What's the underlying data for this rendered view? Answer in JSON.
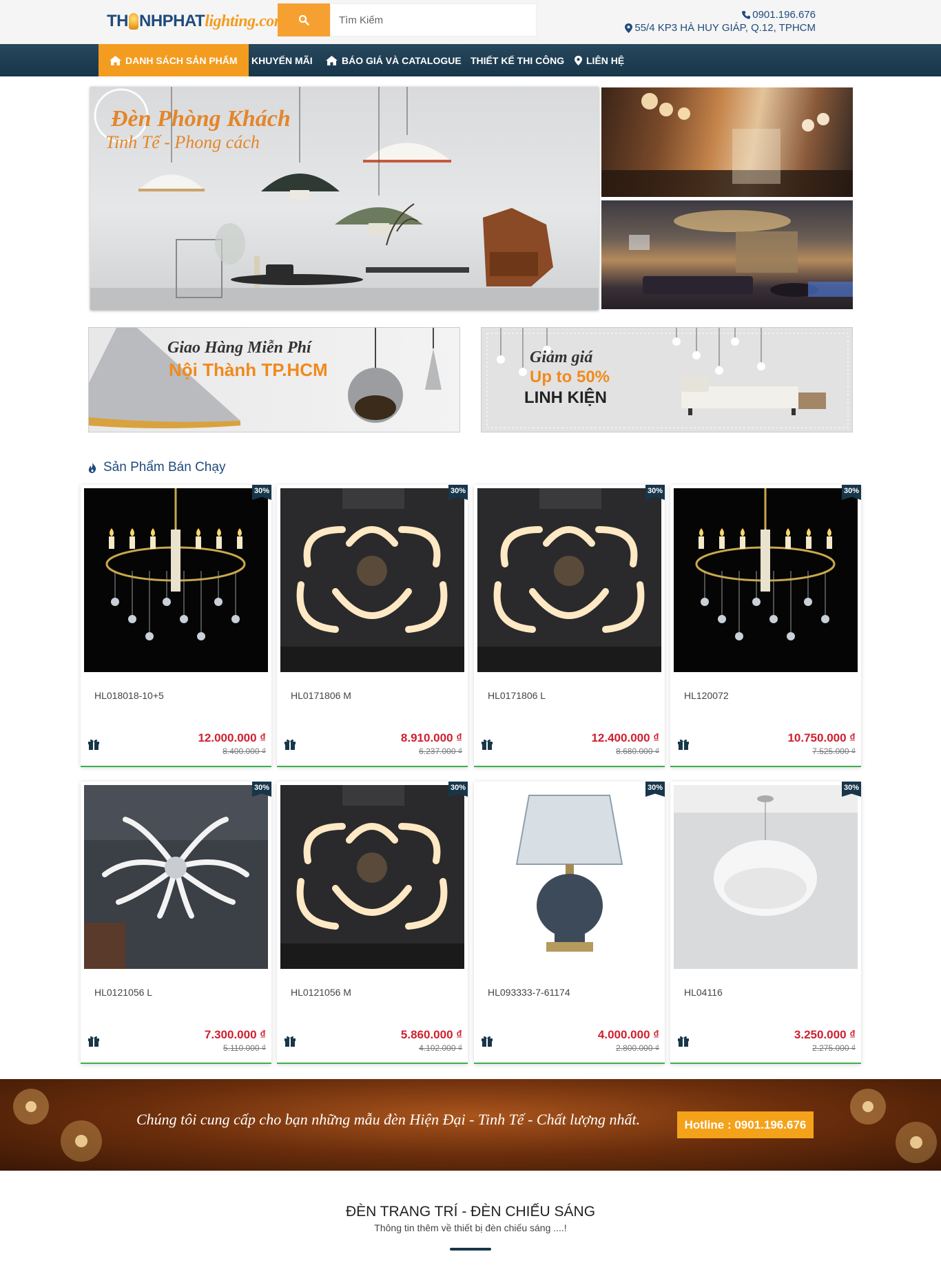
{
  "header": {
    "logo_part1": "TH",
    "logo_part2": "NHPHAT",
    "logo_part3": "lighting.com",
    "search_placeholder": "Tìm Kiếm",
    "phone": "0901.196.676",
    "address": "55/4 KP3 HÀ HUY GIÁP, Q.12, TPHCM"
  },
  "nav": {
    "items": [
      {
        "label": "DANH SÁCH SẢN PHẨM",
        "icon": "home-icon"
      },
      {
        "label": "KHUYẾN MÃI",
        "icon": ""
      },
      {
        "label": "BÁO GIÁ VÀ CATALOGUE",
        "icon": "home-icon"
      },
      {
        "label": "THIẾT KẾ THI CÔNG",
        "icon": ""
      },
      {
        "label": "LIÊN HỆ",
        "icon": "map-marker-icon"
      }
    ]
  },
  "banners": {
    "main_line1": "Đèn Phòng Khách",
    "main_line2": "Tinh Tế - Phong cách",
    "promo1_line1": "Giao Hàng Miễn Phí",
    "promo1_line2": "Nội Thành TP.HCM",
    "promo2_line1": "Giảm giá",
    "promo2_line2": "Up to 50%",
    "promo2_line3": "LINH KIỆN"
  },
  "section": {
    "title": "Sản Phẩm Bán Chạy",
    "icon": "fire-icon"
  },
  "products": [
    {
      "name": "HL018018-10+5",
      "price": "12.000.000 ₫",
      "old_price": "8.400.000 ₫",
      "discount": "30%",
      "image": "crystal-chandelier"
    },
    {
      "name": "HL0171806 M",
      "price": "8.910.000 ₫",
      "old_price": "6.237.000 ₫",
      "discount": "30%",
      "image": "led-ring-chandelier"
    },
    {
      "name": "HL0171806 L",
      "price": "12.400.000 ₫",
      "old_price": "8.680.000 ₫",
      "discount": "30%",
      "image": "led-ring-chandelier"
    },
    {
      "name": "HL120072",
      "price": "10.750.000 ₫",
      "old_price": "7.525.000 ₫",
      "discount": "30%",
      "image": "crystal-chandelier"
    },
    {
      "name": "HL0121056 L",
      "price": "7.300.000 ₫",
      "old_price": "5.110.000 ₫",
      "discount": "30%",
      "image": "led-branch-chandelier"
    },
    {
      "name": "HL0121056 M",
      "price": "5.860.000 ₫",
      "old_price": "4.102.000 ₫",
      "discount": "30%",
      "image": "led-ring-chandelier"
    },
    {
      "name": "HL093333-7-61174",
      "price": "4.000.000 ₫",
      "old_price": "2.800.000 ₫",
      "discount": "30%",
      "image": "table-lamp"
    },
    {
      "name": "HL04116",
      "price": "3.250.000 ₫",
      "old_price": "2.275.000 ₫",
      "discount": "30%",
      "image": "feather-pendant"
    }
  ],
  "cta": {
    "text": "Chúng tôi cung cấp cho bạn những mẫu đèn Hiện Đại - Tinh Tế - Chất lượng nhất.",
    "hotline": "Hotline : 0901.196.676"
  },
  "footer": {
    "title": "ĐÈN TRANG TRÍ - ĐÈN CHIẾU SÁNG",
    "subtitle": "Thông tin thêm về thiết bị đèn chiếu sáng ....!"
  },
  "colors": {
    "brand_blue": "#1f4a7c",
    "nav_dark": "#17364a",
    "accent_orange": "#f39c1f",
    "price_red": "#d01f2f",
    "card_green": "#3cae4e"
  }
}
